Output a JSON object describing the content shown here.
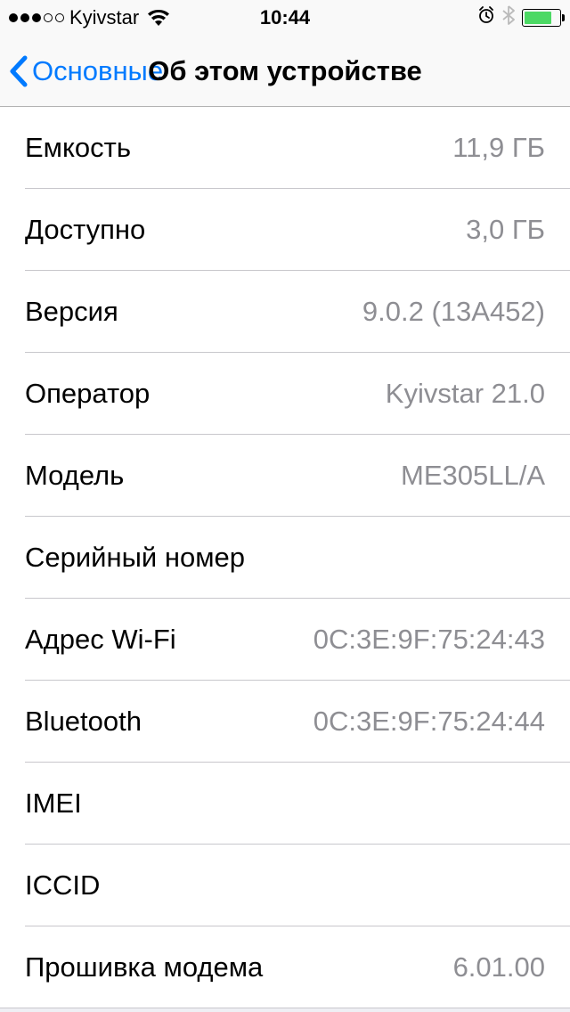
{
  "statusBar": {
    "carrier": "Kyivstar",
    "time": "10:44"
  },
  "nav": {
    "backLabel": "Основные",
    "title": "Об этом устройстве"
  },
  "rows": [
    {
      "label": "Емкость",
      "value": "11,9 ГБ"
    },
    {
      "label": "Доступно",
      "value": "3,0 ГБ"
    },
    {
      "label": "Версия",
      "value": "9.0.2 (13A452)"
    },
    {
      "label": "Оператор",
      "value": "Kyivstar 21.0"
    },
    {
      "label": "Модель",
      "value": "ME305LL/A"
    },
    {
      "label": "Серийный номер",
      "value": ""
    },
    {
      "label": "Адрес Wi-Fi",
      "value": "0C:3E:9F:75:24:43"
    },
    {
      "label": "Bluetooth",
      "value": "0C:3E:9F:75:24:44"
    },
    {
      "label": "IMEI",
      "value": ""
    },
    {
      "label": "ICCID",
      "value": ""
    },
    {
      "label": "Прошивка модема",
      "value": "6.01.00"
    }
  ]
}
